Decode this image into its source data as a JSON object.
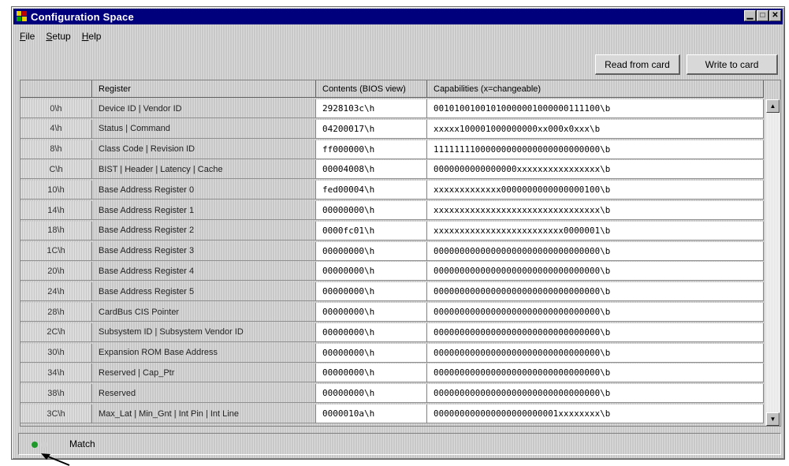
{
  "window": {
    "title": "Configuration Space",
    "controls": {
      "minimize": "▁",
      "maximize": "□",
      "close": "✕"
    }
  },
  "menu": [
    "File",
    "Setup",
    "Help"
  ],
  "toolbar": {
    "read_label": "Read from card",
    "write_label": "Write to card"
  },
  "table": {
    "headers": [
      "",
      "Register",
      "Contents (BIOS view)",
      "Capabilities (x=changeable)"
    ],
    "rows": [
      {
        "offset": "0\\h",
        "register": "Device ID | Vendor ID",
        "contents": "2928103c\\h",
        "capabilities": "00101001001010000001000000111100\\b"
      },
      {
        "offset": "4\\h",
        "register": "Status | Command",
        "contents": "04200017\\h",
        "capabilities": "xxxxx100001000000000xx000x0xxx\\b"
      },
      {
        "offset": "8\\h",
        "register": "Class Code | Revision ID",
        "contents": "ff000000\\h",
        "capabilities": "11111111000000000000000000000000\\b"
      },
      {
        "offset": "C\\h",
        "register": "BIST | Header | Latency | Cache",
        "contents": "00004008\\h",
        "capabilities": "0000000000000000xxxxxxxxxxxxxxxx\\b"
      },
      {
        "offset": "10\\h",
        "register": "Base Address Register 0",
        "contents": "fed00004\\h",
        "capabilities": "xxxxxxxxxxxxx0000000000000000100\\b"
      },
      {
        "offset": "14\\h",
        "register": "Base Address Register 1",
        "contents": "00000000\\h",
        "capabilities": "xxxxxxxxxxxxxxxxxxxxxxxxxxxxxxxx\\b"
      },
      {
        "offset": "18\\h",
        "register": "Base Address Register 2",
        "contents": "0000fc01\\h",
        "capabilities": "xxxxxxxxxxxxxxxxxxxxxxxxx0000001\\b"
      },
      {
        "offset": "1C\\h",
        "register": "Base Address Register 3",
        "contents": "00000000\\h",
        "capabilities": "00000000000000000000000000000000\\b"
      },
      {
        "offset": "20\\h",
        "register": "Base Address Register 4",
        "contents": "00000000\\h",
        "capabilities": "00000000000000000000000000000000\\b"
      },
      {
        "offset": "24\\h",
        "register": "Base Address Register 5",
        "contents": "00000000\\h",
        "capabilities": "00000000000000000000000000000000\\b"
      },
      {
        "offset": "28\\h",
        "register": "CardBus CIS Pointer",
        "contents": "00000000\\h",
        "capabilities": "00000000000000000000000000000000\\b"
      },
      {
        "offset": "2C\\h",
        "register": "Subsystem ID | Subsystem Vendor ID",
        "contents": "00000000\\h",
        "capabilities": "00000000000000000000000000000000\\b"
      },
      {
        "offset": "30\\h",
        "register": "Expansion ROM Base Address",
        "contents": "00000000\\h",
        "capabilities": "00000000000000000000000000000000\\b"
      },
      {
        "offset": "34\\h",
        "register": "Reserved | Cap_Ptr",
        "contents": "00000000\\h",
        "capabilities": "00000000000000000000000000000000\\b"
      },
      {
        "offset": "38\\h",
        "register": "Reserved",
        "contents": "00000000\\h",
        "capabilities": "00000000000000000000000000000000\\b"
      },
      {
        "offset": "3C\\h",
        "register": "Max_Lat | Min_Gnt | Int Pin | Int Line",
        "contents": "0000010a\\h",
        "capabilities": "000000000000000000000001xxxxxxxx\\b"
      }
    ]
  },
  "status": {
    "text": "Match",
    "led_on": "#1f9a2a",
    "led_off": "#d0d0d0"
  },
  "colors": {
    "title_bar": "#00007c",
    "window_bg": "#c8c8c8"
  }
}
